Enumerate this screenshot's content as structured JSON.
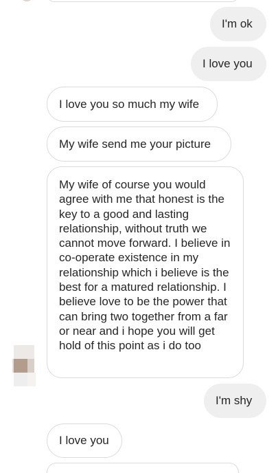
{
  "messages": [
    {
      "direction": "out",
      "text": "I'm ok"
    },
    {
      "direction": "out",
      "text": "I love you"
    },
    {
      "direction": "in",
      "text": "I love you so much my wife"
    },
    {
      "direction": "in",
      "text": "My wife send me your picture"
    },
    {
      "direction": "in",
      "text": "My wife of course you would agree with me that honest is the key to a good and lasting relationship, without truth we cannot move forward. I believe in co-operate existence in my relationship which i believe is the best for a matured relationship. I believe love to be the power that can bring two together from a far or near and i hope you will get hold of this point as i do too"
    },
    {
      "direction": "out",
      "text": "I'm shy"
    },
    {
      "direction": "in",
      "text": "I love you"
    }
  ],
  "colors": {
    "outgoing_bubble": "#efefef",
    "incoming_border": "#dbdbdb",
    "text": "#262626"
  },
  "avatar_icon": "blurred-avatar-icon"
}
